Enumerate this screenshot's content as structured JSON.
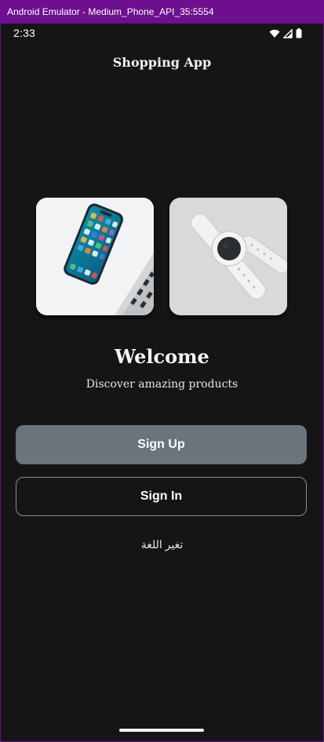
{
  "window": {
    "title": "Android Emulator - Medium_Phone_API_35:5554"
  },
  "status_bar": {
    "time": "2:33",
    "icons": [
      "wifi-icon",
      "signal-icon",
      "battery-icon"
    ]
  },
  "app_bar": {
    "title": "Shopping App"
  },
  "products": [
    {
      "name": "smartphone-image"
    },
    {
      "name": "smartwatch-image"
    }
  ],
  "hero": {
    "title": "Welcome",
    "subtitle": "Discover amazing products"
  },
  "actions": {
    "sign_up_label": "Sign Up",
    "sign_in_label": "Sign In",
    "change_language_label": "تغير اللغة"
  },
  "colors": {
    "window_chrome": "#6d0f8e",
    "background": "#151515",
    "primary_button": "#6b737b",
    "outline": "#8c8c8c"
  }
}
